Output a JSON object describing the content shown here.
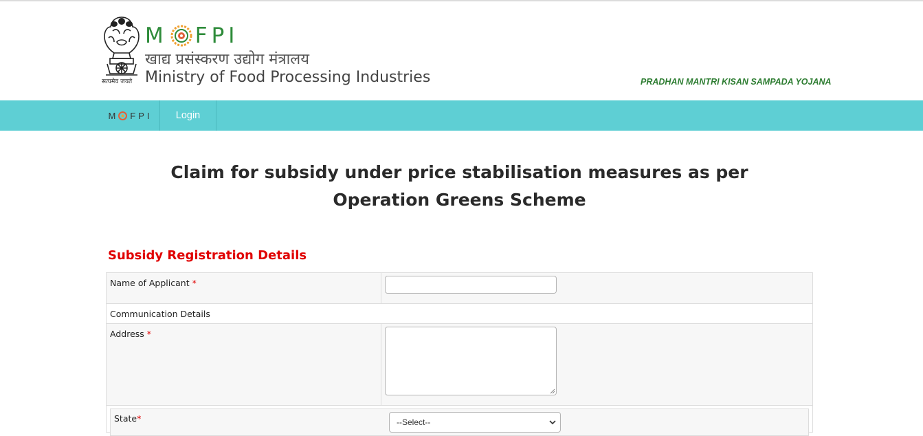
{
  "header": {
    "emblem_caption": "सत्यमेव जयते",
    "logo_letters": [
      "M",
      "F",
      "P",
      "I"
    ],
    "hindi_name": "खाद्य प्रसंस्करण उद्योग मंत्रालय",
    "ministry_name": "Ministry of Food Processing Industries",
    "scheme_tag": "PRADHAN MANTRI KISAN SAMPADA YOJANA",
    "logo_colors": {
      "green": "#2e8b3a",
      "orange": "#f0a030",
      "red": "#e0603a"
    }
  },
  "navbar": {
    "brand_letters": [
      "M",
      "F",
      "P",
      "I"
    ],
    "login_label": "Login",
    "background": "#5ecfd4"
  },
  "main": {
    "title": "Claim for subsidy under price stabilisation measures as per Operation Greens Scheme",
    "section_heading": "Subsidy Registration Details",
    "fields": {
      "name_label": "Name of Applicant",
      "required_mark": "*",
      "communication_label": "Communication Details",
      "address_label": "Address",
      "state_label": "State",
      "state_selected": "--Select--"
    }
  }
}
